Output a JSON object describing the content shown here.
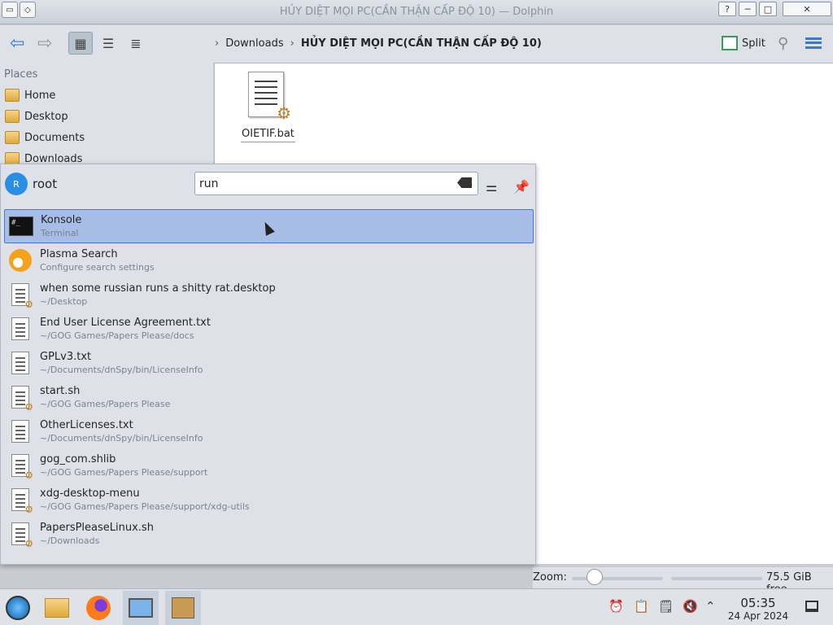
{
  "window": {
    "title": "HỦY DIỆT MỌI PC(CẦN THẬN CẤP ĐỘ 10) — Dolphin",
    "btn_help": "?",
    "btn_min": "─",
    "btn_max": "□",
    "btn_close": "✕"
  },
  "toolbar": {
    "back": "⇦",
    "forward": "⇨",
    "split_label": "Split"
  },
  "breadcrumb": {
    "parent": "Downloads",
    "current": "HỦY DIỆT MỌI PC(CẦN THẬN CẤP ĐỘ 10)"
  },
  "places": {
    "header": "Places",
    "items": [
      "Home",
      "Desktop",
      "Documents",
      "Downloads"
    ]
  },
  "file": {
    "name": "OIETIF.bat"
  },
  "status": {
    "zoom_label": "Zoom:",
    "free_space": "75.5 GiB free"
  },
  "krunner": {
    "user": "root",
    "avatar_letter": "R",
    "query": "run",
    "results": [
      {
        "title": "Konsole",
        "subtitle": "Terminal",
        "icon": "konsole-icon"
      },
      {
        "title": "Plasma Search",
        "subtitle": "Configure search settings",
        "icon": "plasma-search-icon"
      },
      {
        "title": "when some russian runs a shitty rat.desktop",
        "subtitle": "~/Desktop",
        "icon": "desktop-file-icon"
      },
      {
        "title": "End User License Agreement.txt",
        "subtitle": "~/GOG Games/Papers Please/docs",
        "icon": "text-file-icon"
      },
      {
        "title": "GPLv3.txt",
        "subtitle": "~/Documents/dnSpy/bin/LicenseInfo",
        "icon": "text-file-icon"
      },
      {
        "title": "start.sh",
        "subtitle": "~/GOG Games/Papers Please",
        "icon": "script-file-icon"
      },
      {
        "title": "OtherLicenses.txt",
        "subtitle": "~/Documents/dnSpy/bin/LicenseInfo",
        "icon": "text-file-icon"
      },
      {
        "title": "gog_com.shlib",
        "subtitle": "~/GOG Games/Papers Please/support",
        "icon": "script-file-icon"
      },
      {
        "title": "xdg-desktop-menu",
        "subtitle": "~/GOG Games/Papers Please/support/xdg-utils",
        "icon": "script-file-icon"
      },
      {
        "title": "PapersPleaseLinux.sh",
        "subtitle": "~/Downloads",
        "icon": "script-file-icon"
      }
    ]
  },
  "clock": {
    "time": "05:35",
    "date": "24 Apr 2024"
  }
}
